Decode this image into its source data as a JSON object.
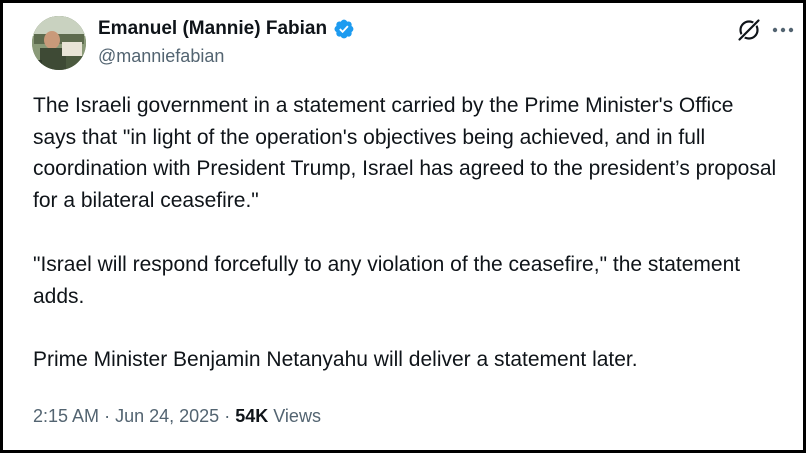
{
  "author": {
    "display_name": "Emanuel (Mannie) Fabian",
    "handle": "@manniefabian",
    "verified": true,
    "verified_color": "#1d9bf0"
  },
  "tweet": {
    "paragraphs": [
      "The Israeli government in a statement carried by the Prime Minister's Office says that \"in light of the operation's objectives being achieved, and in full coordination with President Trump, Israel has agreed to the president’s proposal for a bilateral ceasefire.\"",
      "\"Israel will respond forcefully to any violation of the ceasefire,\" the statement adds.",
      "Prime Minister Benjamin Netanyahu will deliver a statement later."
    ]
  },
  "meta": {
    "time": "2:15 AM",
    "separator": "·",
    "date": "Jun 24, 2025",
    "views_count": "54K",
    "views_label": "Views"
  },
  "icons": {
    "grok": "grok-icon",
    "more": "more-options-icon",
    "verified": "verified-badge-icon"
  }
}
